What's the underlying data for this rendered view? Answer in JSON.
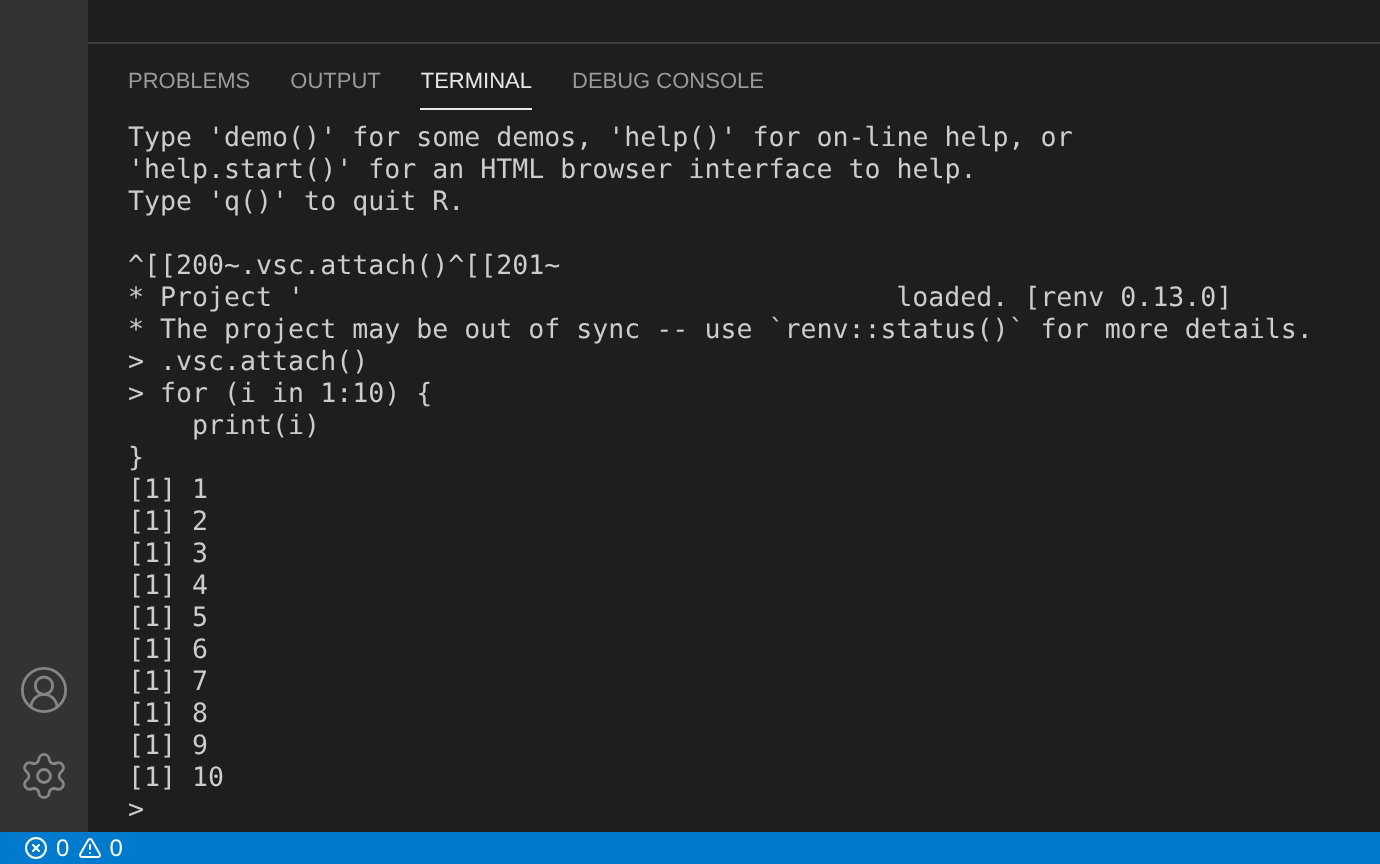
{
  "panel": {
    "tabs": [
      {
        "label": "PROBLEMS",
        "selected": false
      },
      {
        "label": "OUTPUT",
        "selected": false
      },
      {
        "label": "TERMINAL",
        "selected": true
      },
      {
        "label": "DEBUG CONSOLE",
        "selected": false
      }
    ]
  },
  "terminal": {
    "lines": [
      {
        "kind": "text",
        "text": "Type 'demo()' for some demos, 'help()' for on-line help, or"
      },
      {
        "kind": "text",
        "text": "'help.start()' for an HTML browser interface to help."
      },
      {
        "kind": "text",
        "text": "Type 'q()' to quit R."
      },
      {
        "kind": "blank"
      },
      {
        "kind": "text",
        "text": "^[[200~.vsc.attach()^[[201~"
      },
      {
        "kind": "split",
        "before": "* Project '",
        "after": "loaded. [renv 0.13.0]"
      },
      {
        "kind": "text",
        "text": "* The project may be out of sync -- use `renv::status()` for more details."
      },
      {
        "kind": "text",
        "text": "> .vsc.attach()"
      },
      {
        "kind": "text",
        "text": "> for (i in 1:10) {"
      },
      {
        "kind": "text",
        "text": "    print(i)"
      },
      {
        "kind": "text",
        "text": "}"
      },
      {
        "kind": "text",
        "text": "[1] 1"
      },
      {
        "kind": "text",
        "text": "[1] 2"
      },
      {
        "kind": "text",
        "text": "[1] 3"
      },
      {
        "kind": "text",
        "text": "[1] 4"
      },
      {
        "kind": "text",
        "text": "[1] 5"
      },
      {
        "kind": "text",
        "text": "[1] 6"
      },
      {
        "kind": "text",
        "text": "[1] 7"
      },
      {
        "kind": "text",
        "text": "[1] 8"
      },
      {
        "kind": "text",
        "text": "[1] 9"
      },
      {
        "kind": "text",
        "text": "[1] 10"
      },
      {
        "kind": "text",
        "text": ">"
      }
    ]
  },
  "status_bar": {
    "errors": "0",
    "warnings": "0"
  }
}
